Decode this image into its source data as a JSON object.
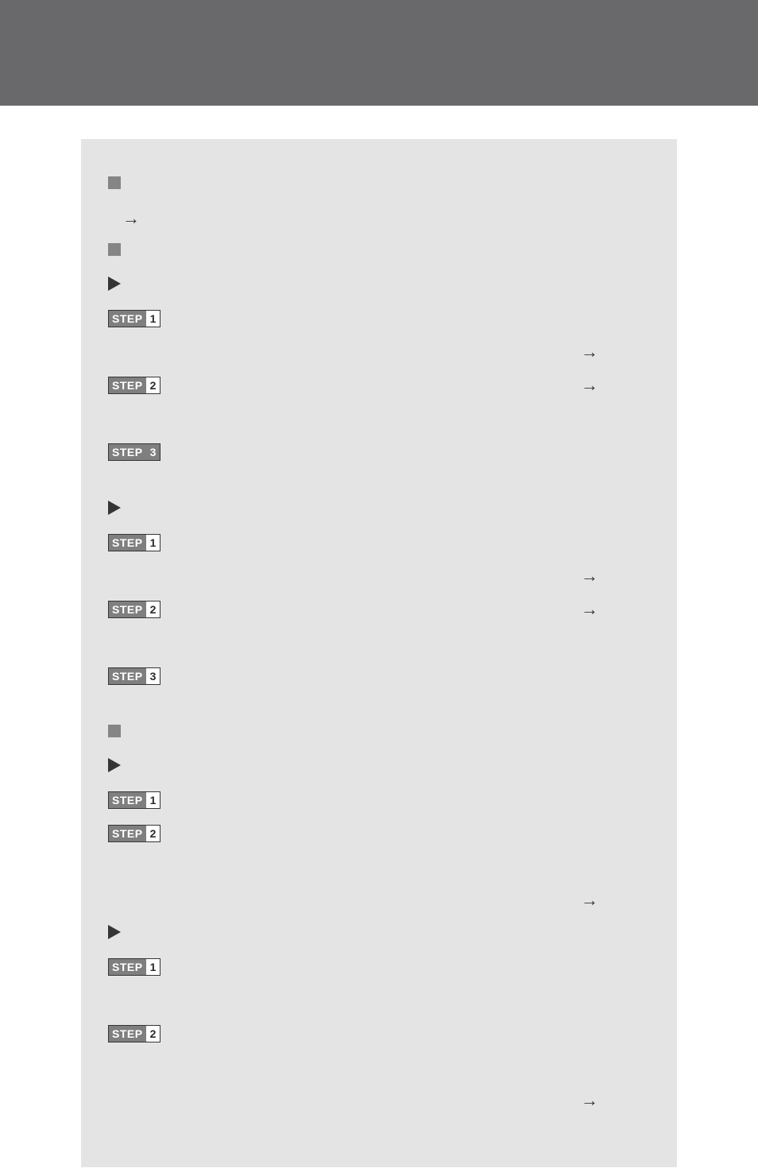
{
  "step_label": "STEP",
  "arrow_glyph": "→",
  "sections": [
    {
      "type": "square"
    },
    {
      "type": "arrow_indent"
    },
    {
      "type": "square"
    },
    {
      "type": "tri"
    },
    {
      "type": "step",
      "num": "1"
    },
    {
      "type": "blank",
      "right_arrow": true
    },
    {
      "type": "step",
      "num": "2",
      "right_arrow": true
    },
    {
      "type": "blank"
    },
    {
      "type": "step",
      "num": "3",
      "dark_num": true
    },
    {
      "type": "gap"
    },
    {
      "type": "tri"
    },
    {
      "type": "step",
      "num": "1"
    },
    {
      "type": "blank",
      "right_arrow": true
    },
    {
      "type": "step",
      "num": "2",
      "right_arrow": true
    },
    {
      "type": "blank"
    },
    {
      "type": "step",
      "num": "3"
    },
    {
      "type": "gap"
    },
    {
      "type": "square"
    },
    {
      "type": "tri"
    },
    {
      "type": "step",
      "num": "1"
    },
    {
      "type": "step",
      "num": "2"
    },
    {
      "type": "blank"
    },
    {
      "type": "blank",
      "right_arrow": true
    },
    {
      "type": "tri"
    },
    {
      "type": "step",
      "num": "1"
    },
    {
      "type": "blank"
    },
    {
      "type": "step",
      "num": "2"
    },
    {
      "type": "blank"
    },
    {
      "type": "blank",
      "right_arrow": true
    }
  ]
}
